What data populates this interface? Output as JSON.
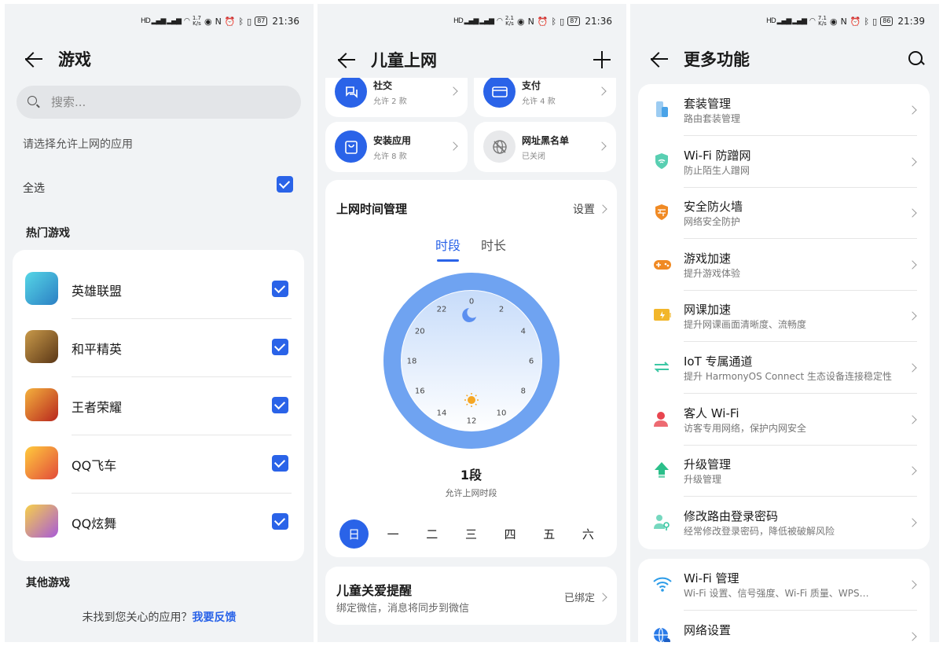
{
  "status_bar": [
    {
      "speed_value": "1.7",
      "speed_unit": "K/s",
      "battery": "87",
      "time": "21:36"
    },
    {
      "speed_value": "2.1",
      "speed_unit": "K/s",
      "battery": "87",
      "time": "21:36"
    },
    {
      "speed_value": "7.1",
      "speed_unit": "K/s",
      "battery": "86",
      "time": "21:39"
    }
  ],
  "games_page": {
    "title": "游戏",
    "search_placeholder": "搜索...",
    "hint": "请选择允许上网的应用",
    "select_all": "全选",
    "hot_section": "热门游戏",
    "games": [
      {
        "name": "英雄联盟",
        "icon": "lol-game-icon",
        "checked": true,
        "color": "#3db6c7"
      },
      {
        "name": "和平精英",
        "icon": "pubg-game-icon",
        "checked": true,
        "color": "#8a5a2b"
      },
      {
        "name": "王者荣耀",
        "icon": "honor-of-kings-icon",
        "checked": true,
        "color": "#d64a2a"
      },
      {
        "name": "QQ飞车",
        "icon": "qq-speed-icon",
        "checked": true,
        "color": "#e9523a"
      },
      {
        "name": "QQ炫舞",
        "icon": "qq-dance-icon",
        "checked": true,
        "color": "#b470d8"
      }
    ],
    "other_section": "其他游戏",
    "feedback_text": "未找到您关心的应用？",
    "feedback_link": "我要反馈"
  },
  "kids_page": {
    "title": "儿童上网",
    "tiles": [
      {
        "name": "社交",
        "sub": "允许 2 款",
        "icon": "chat-icon"
      },
      {
        "name": "支付",
        "sub": "允许 4 款",
        "icon": "payment-card-icon"
      },
      {
        "name": "安装应用",
        "sub": "允许 8 款",
        "icon": "shopping-bag-icon"
      },
      {
        "name": "网址黑名单",
        "sub": "已关闭",
        "icon": "blocked-web-icon"
      }
    ],
    "time_card": {
      "title": "上网时间管理",
      "settings": "设置",
      "tab_period": "时段",
      "tab_duration": "时长",
      "clock_numbers": [
        "0",
        "2",
        "4",
        "6",
        "8",
        "10",
        "12",
        "14",
        "16",
        "18",
        "20",
        "22"
      ],
      "segment_count": "1段",
      "segment_desc": "允许上网时段",
      "days": [
        "日",
        "一",
        "二",
        "三",
        "四",
        "五",
        "六"
      ],
      "selected_day": "日"
    },
    "remind": {
      "title": "儿童关爱提醒",
      "sub": "绑定微信，消息将同步到微信",
      "status": "已绑定"
    }
  },
  "more_page": {
    "title": "更多功能",
    "items": [
      {
        "title": "套装管理",
        "sub": "路由套装管理",
        "icon": "router-set-icon",
        "color": "#4aa3e8"
      },
      {
        "title": "Wi-Fi 防蹭网",
        "sub": "防止陌生人蹭网",
        "icon": "wifi-shield-icon",
        "color": "#3cc7a4"
      },
      {
        "title": "安全防火墙",
        "sub": "网络安全防护",
        "icon": "firewall-icon",
        "color": "#f08a24"
      },
      {
        "title": "游戏加速",
        "sub": "提升游戏体验",
        "icon": "gamepad-icon",
        "color": "#f08a24"
      },
      {
        "title": "网课加速",
        "sub": "提升网课画面清晰度、流畅度",
        "icon": "online-class-icon",
        "color": "#f2b62a"
      },
      {
        "title": "IoT 专属通道",
        "sub": "提升 HarmonyOS Connect 生态设备连接稳定性",
        "icon": "iot-channel-icon",
        "color": "#3cc7a4"
      },
      {
        "title": "客人 Wi-Fi",
        "sub": "访客专用网络，保护内网安全",
        "icon": "guest-user-icon",
        "color": "#e8454f"
      },
      {
        "title": "升级管理",
        "sub": "升级管理",
        "icon": "upgrade-icon",
        "color": "#2bbf8a"
      },
      {
        "title": "修改路由登录密码",
        "sub": "经常修改登录密码，降低被破解风险",
        "icon": "user-key-icon",
        "color": "#3cc7a4"
      }
    ],
    "items2": [
      {
        "title": "Wi-Fi 管理",
        "sub": "Wi-Fi 设置、信号强度、Wi-Fi 质量、WPS…",
        "icon": "wifi-icon",
        "color": "#2a9be8"
      },
      {
        "title": "网络设置",
        "sub": "",
        "icon": "network-globe-icon",
        "color": "#2a7be8"
      }
    ]
  }
}
